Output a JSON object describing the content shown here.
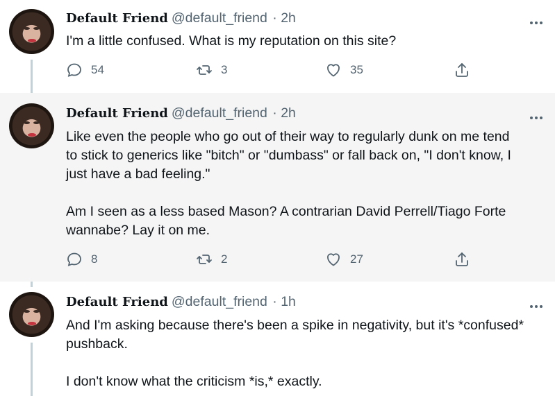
{
  "tweets": [
    {
      "name": "Default Friend",
      "handle": "@default_friend",
      "time": "· 2h",
      "text": "I'm a little confused. What is my reputation on this site?",
      "replies": "54",
      "retweets": "3",
      "likes": "35"
    },
    {
      "name": "Default Friend",
      "handle": "@default_friend",
      "time": "· 2h",
      "text": "Like even the people who go out of their way to regularly dunk on me tend\nto stick to generics like \"bitch\" or \"dumbass\" or fall back on, \"I don't know, I\njust have a bad feeling.\"\n\nAm I seen as a less based Mason? A contrarian David Perrell/Tiago Forte\nwannabe? Lay it on me.",
      "replies": "8",
      "retweets": "2",
      "likes": "27"
    },
    {
      "name": "Default Friend",
      "handle": "@default_friend",
      "time": "· 1h",
      "text": "And I'm asking because there's been a spike in negativity, but it's *confused*\npushback.\n\nI don't know what the criticism *is,* exactly."
    }
  ],
  "icons": {
    "reply": "reply-icon",
    "retweet": "retweet-icon",
    "like": "heart-icon",
    "share": "share-icon",
    "more": "more-icon"
  },
  "colors": {
    "text": "#0f1419",
    "muted": "#536471",
    "thread_line": "#c4cfd6",
    "highlight_bg": "#f5f5f5"
  }
}
